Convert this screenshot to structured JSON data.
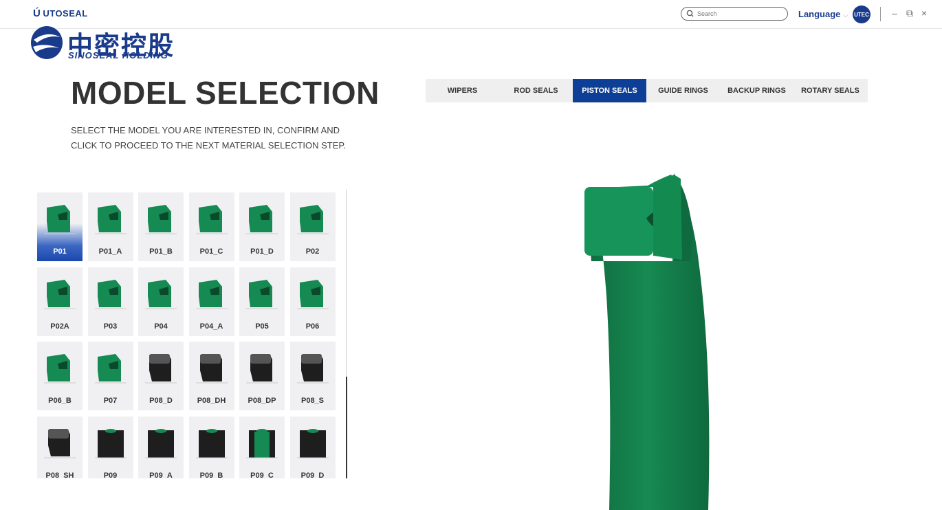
{
  "window": {
    "brand_small": "UTOSEAL",
    "search_placeholder": "Search",
    "language_label": "Language",
    "user_initials": "UTEC",
    "minimize": "–",
    "restore": "⧉",
    "close": "×"
  },
  "logo": {
    "cn": "中密控股",
    "en": "SINOSEAL HOLDING"
  },
  "page": {
    "title": "MODEL SELECTION",
    "subtitle": "SELECT THE MODEL YOU ARE INTERESTED IN, CONFIRM AND CLICK TO PROCEED TO THE NEXT MATERIAL SELECTION STEP."
  },
  "tabs": [
    {
      "label": "WIPERS",
      "active": false
    },
    {
      "label": "ROD SEALS",
      "active": false
    },
    {
      "label": "PISTON SEALS",
      "active": true
    },
    {
      "label": "GUIDE RINGS",
      "active": false
    },
    {
      "label": "BACKUP RINGS",
      "active": false
    },
    {
      "label": "ROTARY SEALS",
      "active": false
    }
  ],
  "models": [
    {
      "label": "P01",
      "selected": true,
      "style": "green"
    },
    {
      "label": "P01_A",
      "style": "green"
    },
    {
      "label": "P01_B",
      "style": "green"
    },
    {
      "label": "P01_C",
      "style": "green"
    },
    {
      "label": "P01_D",
      "style": "green"
    },
    {
      "label": "P02",
      "style": "green"
    },
    {
      "label": "P02A",
      "style": "green"
    },
    {
      "label": "P03",
      "style": "green"
    },
    {
      "label": "P04",
      "style": "green"
    },
    {
      "label": "P04_A",
      "style": "green"
    },
    {
      "label": "P05",
      "style": "green"
    },
    {
      "label": "P06",
      "style": "green"
    },
    {
      "label": "P06_B",
      "style": "green"
    },
    {
      "label": "P07",
      "style": "green"
    },
    {
      "label": "P08_D",
      "style": "black"
    },
    {
      "label": "P08_DH",
      "style": "black"
    },
    {
      "label": "P08_DP",
      "style": "black"
    },
    {
      "label": "P08_S",
      "style": "black"
    },
    {
      "label": "P08_SH",
      "style": "black"
    },
    {
      "label": "P09",
      "style": "channel"
    },
    {
      "label": "P09_A",
      "style": "channel"
    },
    {
      "label": "P09_B",
      "style": "channel"
    },
    {
      "label": "P09_C",
      "style": "channel-green"
    },
    {
      "label": "P09_D",
      "style": "channel"
    }
  ],
  "colors": {
    "accent": "#0e3f96",
    "seal_green": "#158a52",
    "seal_black": "#1e1e1e"
  }
}
